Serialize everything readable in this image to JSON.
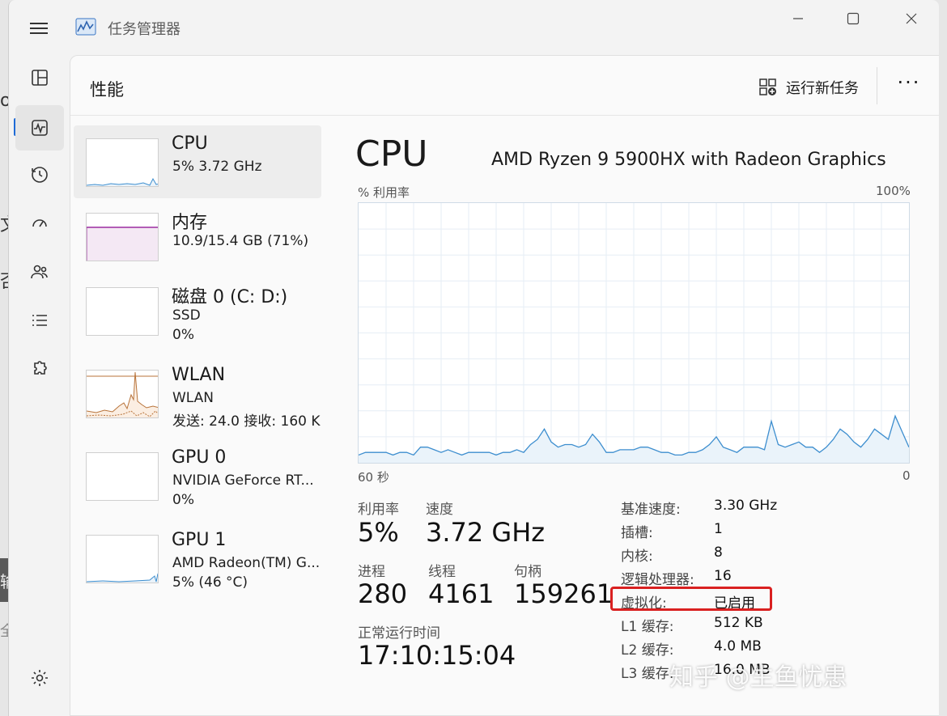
{
  "window": {
    "title": "任务管理器"
  },
  "header": {
    "page_title": "性能",
    "run_task_label": "运行新任务",
    "more_label": "···"
  },
  "resources": [
    {
      "name": "CPU",
      "sub1": "5%  3.72 GHz",
      "sub2": ""
    },
    {
      "name": "内存",
      "sub1": "10.9/15.4 GB (71%)",
      "sub2": ""
    },
    {
      "name": "磁盘 0 (C: D:)",
      "sub1": "SSD",
      "sub2": "0%"
    },
    {
      "name": "WLAN",
      "sub1": "WLAN",
      "sub2": "发送: 24.0  接收: 160 K"
    },
    {
      "name": "GPU 0",
      "sub1": "NVIDIA GeForce RT...",
      "sub2": "0%"
    },
    {
      "name": "GPU 1",
      "sub1": "AMD Radeon(TM) G...",
      "sub2": "5% (46 °C)"
    }
  ],
  "detail": {
    "title": "CPU",
    "model": "AMD Ryzen 9 5900HX with Radeon Graphics",
    "y_label": "% 利用率",
    "y_max": "100%",
    "x_left": "60 秒",
    "x_right": "0"
  },
  "stats": {
    "utilization_label": "利用率",
    "utilization": "5%",
    "speed_label": "速度",
    "speed": "3.72 GHz",
    "processes_label": "进程",
    "processes": "280",
    "threads_label": "线程",
    "threads": "4161",
    "handles_label": "句柄",
    "handles": "159261",
    "uptime_label": "正常运行时间",
    "uptime": "17:10:15:04"
  },
  "specs": [
    {
      "k": "基准速度:",
      "v": "3.30 GHz"
    },
    {
      "k": "插槽:",
      "v": "1"
    },
    {
      "k": "内核:",
      "v": "8"
    },
    {
      "k": "逻辑处理器:",
      "v": "16"
    },
    {
      "k": "虚拟化:",
      "v": "已启用"
    },
    {
      "k": "L1 缓存:",
      "v": "512 KB"
    },
    {
      "k": "L2 缓存:",
      "v": "4.0 MB"
    },
    {
      "k": "L3 缓存:",
      "v": "16.0 MB"
    }
  ],
  "watermark": "知乎 @生鱼忧患",
  "desk_fragments": [
    "oi",
    "文",
    "否",
    "输",
    "全"
  ],
  "colors": {
    "cpu_line": "#3d8ecf",
    "cpu_fill": "#eaf3fa",
    "memory_line": "#9b2ca0",
    "wlan_line": "#b8733a",
    "highlight": "#d92020"
  },
  "cpu_history": [
    3,
    4,
    4,
    4,
    4,
    3,
    4,
    4,
    3,
    6,
    6,
    5,
    4,
    5,
    4,
    3,
    4,
    4,
    4,
    4,
    3,
    4,
    4,
    5,
    4,
    7,
    9,
    13,
    8,
    6,
    7,
    7,
    6,
    7,
    11,
    8,
    4,
    4,
    5,
    5,
    5,
    6,
    6,
    5,
    4,
    4,
    3,
    3,
    4,
    4,
    5,
    7,
    10,
    6,
    5,
    4,
    6,
    6,
    6,
    5,
    16,
    7,
    6,
    7,
    8,
    6,
    6,
    4,
    6,
    9,
    13,
    11,
    8,
    6,
    9,
    13,
    11,
    9,
    18,
    12,
    6
  ]
}
